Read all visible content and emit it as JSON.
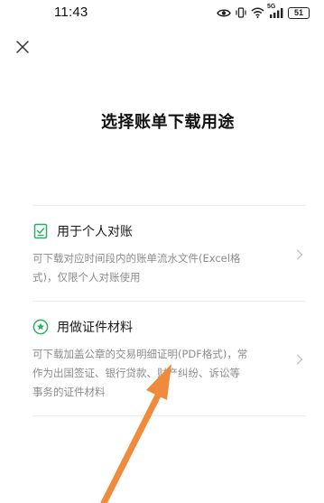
{
  "status_bar": {
    "time": "11:43",
    "network": "5G",
    "battery": "51"
  },
  "page": {
    "title": "选择账单下载用途"
  },
  "options": [
    {
      "title": "用于个人对账",
      "description": "可下载对应时间段内的账单流水文件(Excel格式)，仅限个人对账使用"
    },
    {
      "title": "用做证件材料",
      "description": "可下载加盖公章的交易明细证明(PDF格式)，常作为出国签证、银行贷款、财产纠纷、诉讼等事务的证件材料"
    }
  ],
  "colors": {
    "accent_green": "#2aae67",
    "annotation_arrow": "#f08a3c",
    "muted_text": "#8c8c8c",
    "divider": "#ececec"
  },
  "icons": {
    "close": "close-icon",
    "option_1": "document-check-icon",
    "option_2": "star-badge-icon",
    "chevron": "chevron-right-icon"
  }
}
